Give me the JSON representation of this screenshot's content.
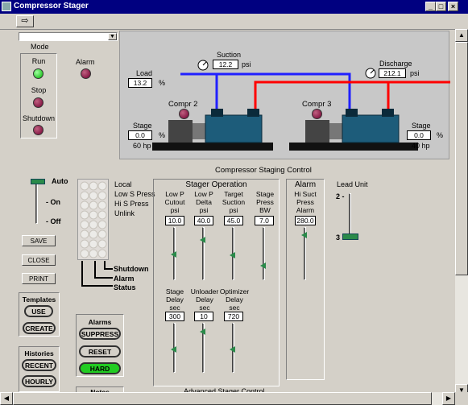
{
  "window": {
    "title": "Compressor Stager"
  },
  "toolbar": {
    "nav_icon": "arrow-right-icon"
  },
  "mode": {
    "label": "Mode",
    "value": ""
  },
  "status_panel": {
    "run_label": "Run",
    "stop_label": "Stop",
    "shutdown_label": "Shutdown",
    "alarm_label": "Alarm"
  },
  "diagram": {
    "load_label": "Load",
    "load_value": "13.2",
    "load_unit": "%",
    "suction_label": "Suction",
    "suction_value": "12.2",
    "suction_unit": "psi",
    "discharge_label": "Discharge",
    "discharge_value": "212.1",
    "discharge_unit": "psi",
    "compr2_label": "Compr 2",
    "compr3_label": "Compr 3",
    "stage_left_label": "Stage",
    "stage_left_value": "0.0",
    "stage_left_unit": "%",
    "stage_left_hp": "60 hp",
    "stage_right_label": "Stage",
    "stage_right_value": "0.0",
    "stage_right_unit": "%",
    "stage_right_hp": "40 hp",
    "colors": {
      "suction_line": "#2020ff",
      "discharge_line": "#ff0000"
    }
  },
  "control_title": "Compressor Staging Control",
  "mode_switch": {
    "auto": "Auto",
    "on": "- On",
    "off": "- Off",
    "position": "Auto"
  },
  "buttons": {
    "save": "SAVE",
    "close": "CLOSE",
    "print": "PRINT"
  },
  "indicators": {
    "items": [
      "Local",
      "Low S Press",
      "Hi S Press",
      "Unlink"
    ],
    "shutdown": "Shutdown",
    "alarm": "Alarm",
    "status": "Status"
  },
  "templates": {
    "title": "Templates",
    "use": "USE",
    "create": "CREATE"
  },
  "histories": {
    "title": "Histories",
    "recent": "RECENT",
    "hourly": "HOURLY"
  },
  "alarms": {
    "title": "Alarms",
    "suppress": "SUPPRESS",
    "reset": "RESET",
    "hard": "HARD"
  },
  "notes": {
    "title": "Notes"
  },
  "stager": {
    "title": "Stager Operation",
    "params": [
      {
        "name": "Low P Cutout psi",
        "l1": "Low P",
        "l2": "Cutout",
        "l3": "psi",
        "value": "10.0"
      },
      {
        "name": "Low P Delta psi",
        "l1": "Low P",
        "l2": "Delta",
        "l3": "psi",
        "value": "40.0"
      },
      {
        "name": "Target Suction psi",
        "l1": "Target",
        "l2": "Suction",
        "l3": "psi",
        "value": "45.0"
      },
      {
        "name": "Stage Press BW psi",
        "l1": "Stage",
        "l2": "Press BW",
        "l3": "psi",
        "value": "7.0"
      }
    ],
    "delays": [
      {
        "l1": "Stage",
        "l2": "Delay",
        "l3": "sec",
        "value": "300"
      },
      {
        "l1": "Unloader",
        "l2": "Delay",
        "l3": "sec",
        "value": "10"
      },
      {
        "l1": "Optimizer",
        "l2": "Delay",
        "l3": "sec",
        "value": "720"
      }
    ]
  },
  "alarm_panel": {
    "title": "Alarm",
    "l1": "Hi Suct",
    "l2": "Press",
    "l3": "Alarm",
    "value": "280.0"
  },
  "lead_unit": {
    "title": "Lead Unit",
    "top": "2 -",
    "bottom": "3",
    "selected": "3"
  },
  "footer_label": "Advanced Stager Control"
}
